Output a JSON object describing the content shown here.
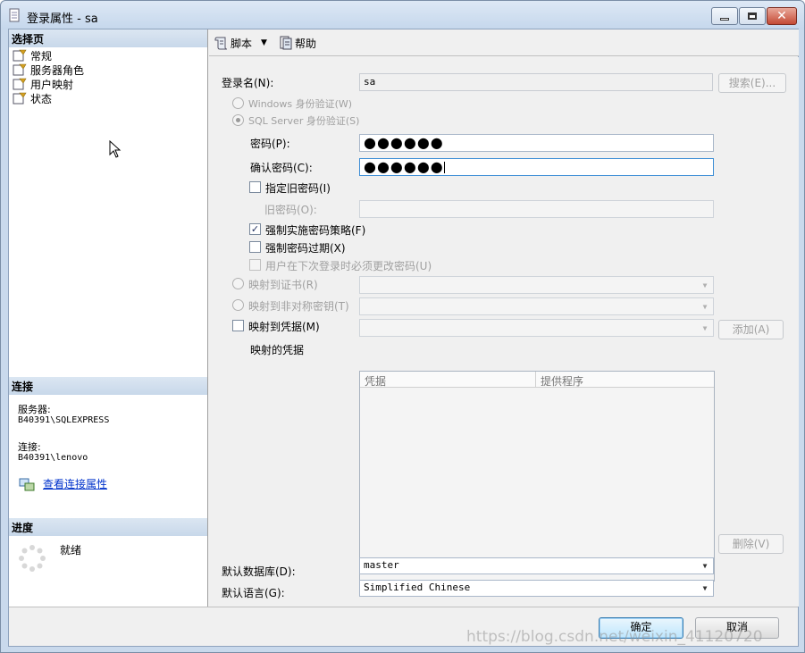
{
  "window": {
    "title": "登录属性 - sa"
  },
  "left": {
    "select_page_header": "选择页",
    "pages": [
      {
        "label": "常规"
      },
      {
        "label": "服务器角色"
      },
      {
        "label": "用户映射"
      },
      {
        "label": "状态"
      }
    ],
    "connection_header": "连接",
    "server_label": "服务器:",
    "server_value": "B40391\\SQLEXPRESS",
    "connection_label": "连接:",
    "connection_value": "B40391\\lenovo",
    "view_conn_props": "查看连接属性",
    "progress_header": "进度",
    "progress_status": "就绪"
  },
  "toolbar": {
    "script_label": "脚本",
    "help_label": "帮助"
  },
  "form": {
    "login_name_label": "登录名(N):",
    "login_name_value": "sa",
    "search_button": "搜索(E)...",
    "windows_auth": "Windows 身份验证(W)",
    "sql_auth": "SQL Server 身份验证(S)",
    "password_label": "密码(P):",
    "password_value": "●●●●●●",
    "confirm_password_label": "确认密码(C):",
    "confirm_password_value": "●●●●●●",
    "specify_old_password": "指定旧密码(I)",
    "old_password_label": "旧密码(O):",
    "enforce_policy": "强制实施密码策略(F)",
    "enforce_expiration": "强制密码过期(X)",
    "must_change": "用户在下次登录时必须更改密码(U)",
    "map_cert": "映射到证书(R)",
    "map_asym_key": "映射到非对称密钥(T)",
    "map_credential": "映射到凭据(M)",
    "add_button": "添加(A)",
    "mapped_credentials_label": "映射的凭据",
    "grid_columns": [
      "凭据",
      "提供程序"
    ],
    "remove_button": "删除(V)",
    "default_db_label": "默认数据库(D):",
    "default_db_value": "master",
    "default_lang_label": "默认语言(G):",
    "default_lang_value": "Simplified Chinese"
  },
  "buttons": {
    "ok": "确定",
    "cancel": "取消"
  },
  "watermark": "https://blog.csdn.net/weixin_41120720"
}
